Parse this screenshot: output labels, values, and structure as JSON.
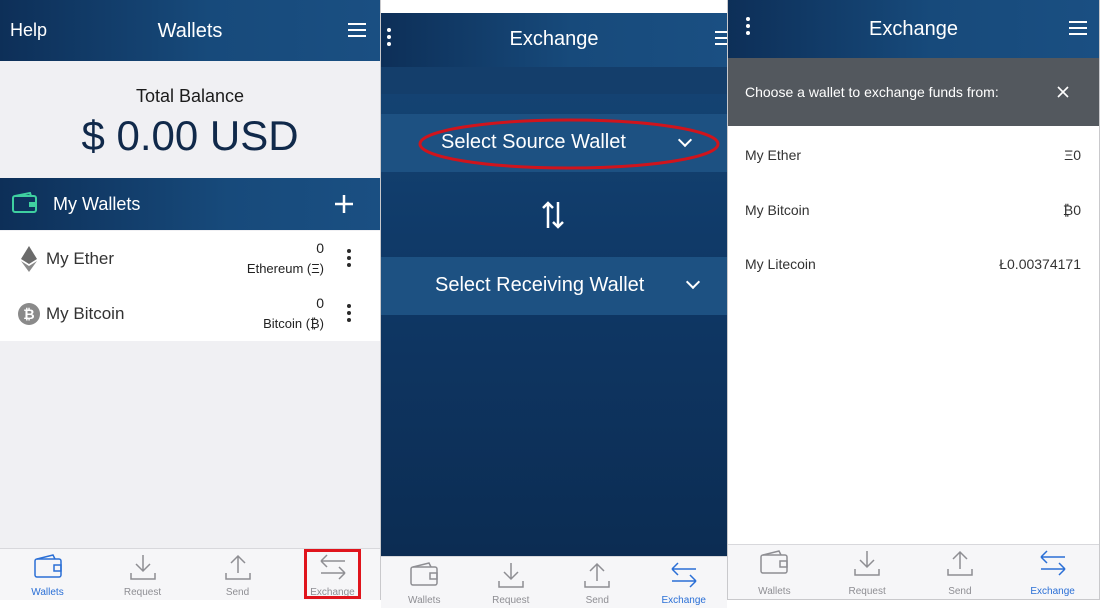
{
  "panel1": {
    "help": "Help",
    "title": "Wallets",
    "balance_label": "Total Balance",
    "balance_value": "$ 0.00 USD",
    "my_wallets": "My Wallets",
    "wallets": [
      {
        "name": "My Ether",
        "amount": "0",
        "currency": "Ethereum (Ξ)",
        "icon": "ethereum-icon"
      },
      {
        "name": "My Bitcoin",
        "amount": "0",
        "currency": "Bitcoin (₿)",
        "icon": "bitcoin-icon"
      }
    ],
    "nav": [
      "Wallets",
      "Request",
      "Send",
      "Exchange"
    ],
    "active_tab": "Wallets",
    "highlight_color": "#e0141c"
  },
  "panel2": {
    "title": "Exchange",
    "source": "Select Source Wallet",
    "receiving": "Select Receiving Wallet",
    "nav": [
      "Wallets",
      "Request",
      "Send",
      "Exchange"
    ],
    "active_tab": "Exchange",
    "highlight_color": "#d0141c"
  },
  "panel3": {
    "title": "Exchange",
    "prompt": "Choose a wallet to exchange funds from:",
    "wallets": [
      {
        "name": "My Ether",
        "value": "Ξ0"
      },
      {
        "name": "My Bitcoin",
        "value": "₿0"
      },
      {
        "name": "My Litecoin",
        "value": "Ł0.00374171"
      }
    ],
    "nav": [
      "Wallets",
      "Request",
      "Send",
      "Exchange"
    ],
    "active_tab": "Exchange"
  },
  "colors": {
    "accent": "#2a6fd6",
    "header": "#174a7b",
    "prompt_bg": "#53585e"
  }
}
